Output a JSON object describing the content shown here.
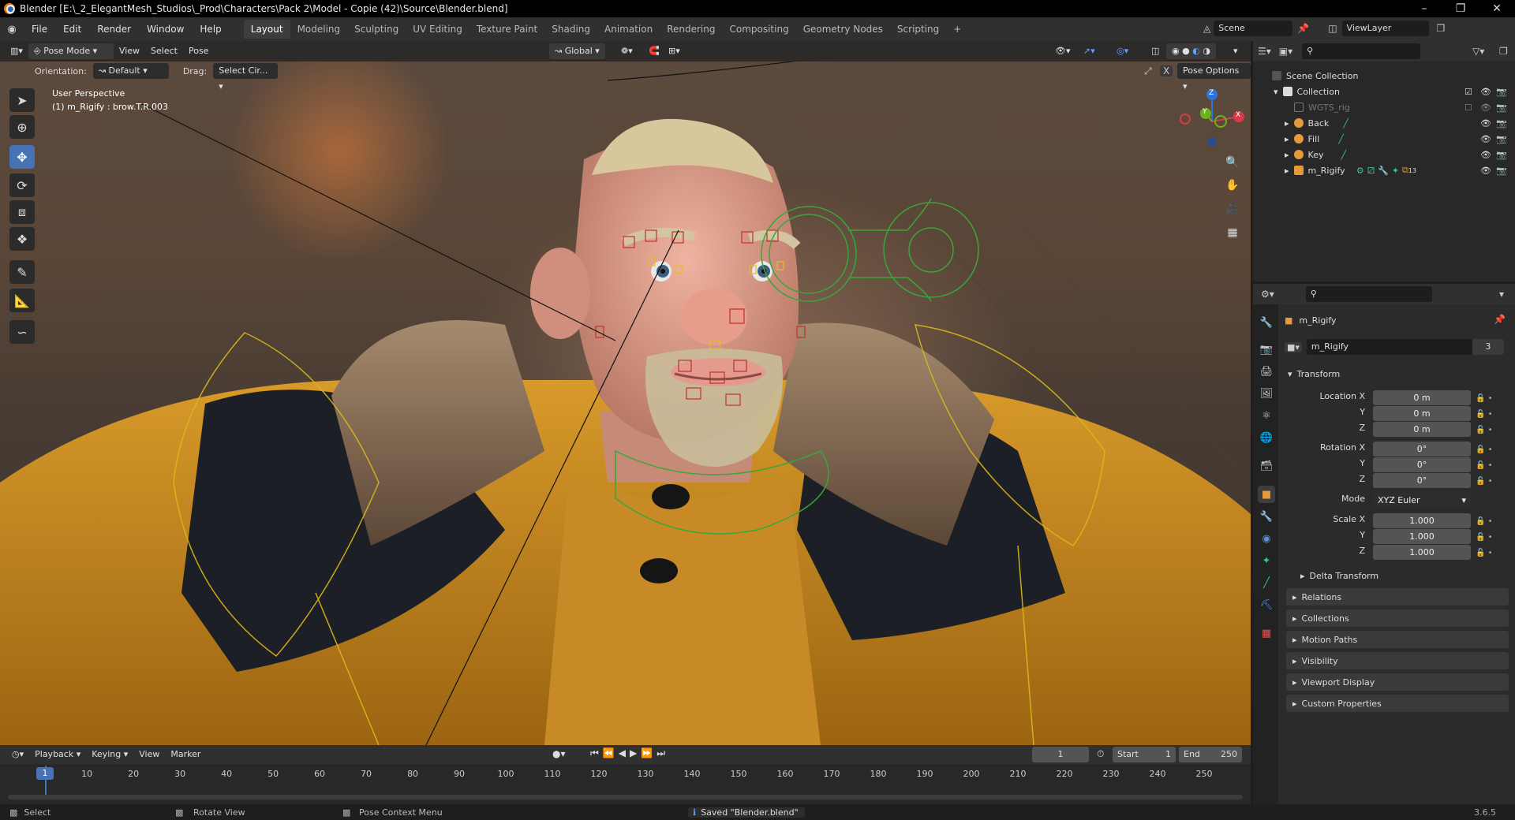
{
  "window": {
    "title": "Blender [E:\\_2_ElegantMesh_Studios\\_Prod\\Characters\\Pack 2\\Model - Copie (42)\\Source\\Blender.blend]"
  },
  "menu": {
    "items": [
      "File",
      "Edit",
      "Render",
      "Window",
      "Help"
    ]
  },
  "workspaces": [
    "Layout",
    "Modeling",
    "Sculpting",
    "UV Editing",
    "Texture Paint",
    "Shading",
    "Animation",
    "Rendering",
    "Compositing",
    "Geometry Nodes",
    "Scripting"
  ],
  "scene": {
    "name": "Scene",
    "view_layer": "ViewLayer"
  },
  "viewport": {
    "mode": "Pose Mode",
    "menus": [
      "View",
      "Select",
      "Pose"
    ],
    "transform_orientation": "Global",
    "orientation_label": "Orientation:",
    "orientation_value": "Default",
    "drag_label": "Drag:",
    "drag_value": "Select Cir...",
    "pose_options": "Pose Options",
    "info_line1": "User Perspective",
    "info_line2": "(1) m_Rigify : brow.T.R.003",
    "gizmo": {
      "x": "X",
      "y": "Y",
      "z": "Z"
    }
  },
  "outliner": {
    "root": "Scene Collection",
    "collection": "Collection",
    "items": [
      {
        "name": "WGTS_rig",
        "dim": true
      },
      {
        "name": "Back"
      },
      {
        "name": "Fill"
      },
      {
        "name": "Key"
      },
      {
        "name": "m_Rigify"
      }
    ],
    "rigify_count": "13"
  },
  "properties": {
    "object_name": "m_Rigify",
    "data_name": "m_Rigify",
    "users": "3",
    "transform_label": "Transform",
    "location": {
      "label": "Location X",
      "x": "0 m",
      "y": "0 m",
      "z": "0 m"
    },
    "rotation": {
      "label": "Rotation X",
      "x": "0°",
      "y": "0°",
      "z": "0°"
    },
    "mode_label": "Mode",
    "mode_value": "XYZ Euler",
    "scale": {
      "label": "Scale X",
      "x": "1.000",
      "y": "1.000",
      "z": "1.000"
    },
    "axis_y": "Y",
    "axis_z": "Z",
    "delta": "Delta Transform",
    "panels": [
      "Relations",
      "Collections",
      "Motion Paths",
      "Visibility",
      "Viewport Display",
      "Custom Properties"
    ]
  },
  "timeline": {
    "menus": [
      "Playback",
      "Keying",
      "View",
      "Marker"
    ],
    "current_frame": "1",
    "start_label": "Start",
    "start": "1",
    "end_label": "End",
    "end": "250",
    "ticks": [
      "1",
      "10",
      "20",
      "30",
      "40",
      "50",
      "60",
      "70",
      "80",
      "90",
      "100",
      "110",
      "120",
      "130",
      "140",
      "150",
      "160",
      "170",
      "180",
      "190",
      "200",
      "210",
      "220",
      "230",
      "240",
      "250"
    ]
  },
  "status": {
    "select": "Select",
    "rotate": "Rotate View",
    "context": "Pose Context Menu",
    "saved": "Saved \"Blender.blend\"",
    "version": "3.6.5"
  }
}
